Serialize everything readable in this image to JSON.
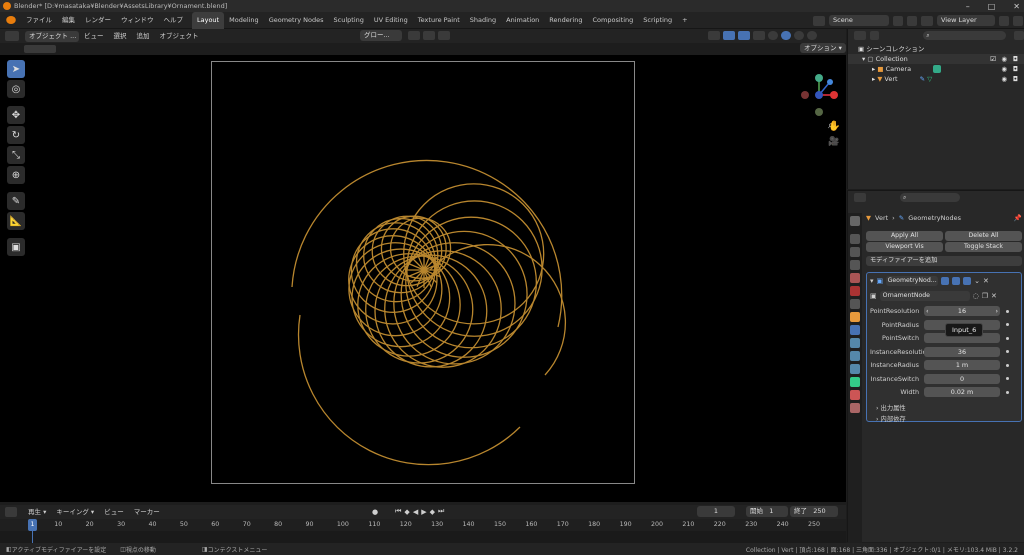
{
  "title": "Blender* [D:¥masataka¥Blender¥AssetsLibrary¥Ornament.blend]",
  "menus": [
    "ファイル",
    "編集",
    "レンダー",
    "ウィンドウ",
    "ヘルプ"
  ],
  "workspaces": [
    "Layout",
    "Modeling",
    "Geometry Nodes",
    "Sculpting",
    "UV Editing",
    "Texture Paint",
    "Shading",
    "Animation",
    "Rendering",
    "Compositing",
    "Scripting"
  ],
  "add_workspace": "+",
  "scene": "Scene",
  "view_layer": "View Layer",
  "viewport_header": {
    "mode": "オブジェクト ...",
    "menu": [
      "ビュー",
      "選択",
      "追加",
      "オブジェクト"
    ],
    "orientation": "グロー...",
    "options": "オプション ▾"
  },
  "outliner": {
    "title": "シーンコレクション",
    "items": [
      {
        "name": "Collection",
        "level": 0
      },
      {
        "name": "Camera",
        "level": 1
      },
      {
        "name": "Vert",
        "level": 1
      }
    ]
  },
  "properties": {
    "breadcrumb_obj": "Vert",
    "breadcrumb_mod": "GeometryNodes",
    "apply_all": "Apply All",
    "delete_all": "Delete All",
    "viewport_vis": "Viewport Vis",
    "toggle_stack": "Toggle Stack",
    "add_modifier": "モディファイアーを追加",
    "modifier_name": "GeometryNod...",
    "node_group": "OrnamentNode",
    "tooltip": "Input_6",
    "rows": [
      {
        "label": "PointResolution",
        "value": "16"
      },
      {
        "label": "PointRadius",
        "value": ""
      },
      {
        "label": "PointSwitch",
        "value": ""
      },
      {
        "label": "InstanceResolution",
        "value": "36"
      },
      {
        "label": "InstanceRadius",
        "value": "1 m"
      },
      {
        "label": "InstanceSwitch",
        "value": "0"
      },
      {
        "label": "Width",
        "value": "0.02 m"
      }
    ],
    "output_attrs": "出力属性",
    "internal_deps": "内部依存"
  },
  "timeline": {
    "menus": [
      "再生 ▾",
      "キーイング ▾",
      "ビュー",
      "マーカー"
    ],
    "current_frame": "1",
    "start_label": "開始",
    "start": "1",
    "end_label": "終了",
    "end": "250",
    "ticks": [
      "1",
      "10",
      "20",
      "30",
      "40",
      "50",
      "60",
      "70",
      "80",
      "90",
      "100",
      "110",
      "120",
      "130",
      "140",
      "150",
      "160",
      "170",
      "180",
      "190",
      "200",
      "210",
      "220",
      "230",
      "240",
      "250"
    ]
  },
  "status": {
    "left1": "アクティブモディファイアーを設定",
    "left2": "視点の移動",
    "left3": "コンテクストメニュー",
    "right": "Collection | Vert | 頂点:168 | 面:168 | 三角面:336 | オブジェクト:0/1 | メモリ:103.4 MiB | 3.2.2"
  },
  "colors": {
    "accent": "#4772b3",
    "curve": "#b8862e",
    "active_tab": "#3d3d3d"
  }
}
